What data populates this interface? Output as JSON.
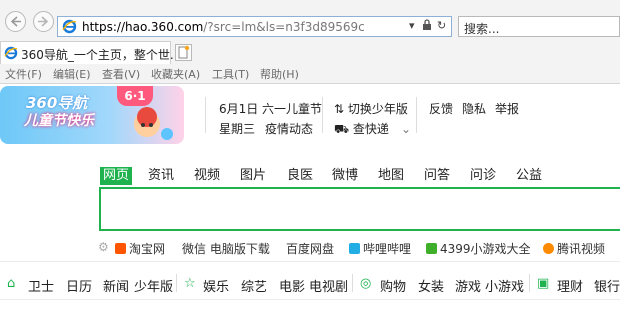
{
  "browser": {
    "url_host": "https://hao.360.com",
    "url_rest": "/?src=lm&ls=n3f3d89569c",
    "url_controls": [
      "▾",
      "🔒",
      "↻"
    ],
    "search_placeholder": "搜索...",
    "tab_title": "360导航_一个主页，整个世...",
    "menu": [
      "文件(F)",
      "编辑(E)",
      "查看(V)",
      "收藏夹(A)",
      "工具(T)",
      "帮助(H)"
    ]
  },
  "header": {
    "banner_line1": "360导航",
    "banner_line2": "儿童节快乐",
    "banner_badge": "6·1",
    "date": "6月1日",
    "festival": "六一儿童节",
    "weekday": "星期三",
    "epidemic": "疫情动态",
    "youth_switch": "切换少年版",
    "express": "查快递",
    "feedback": "反馈",
    "privacy": "隐私",
    "report": "举报"
  },
  "search_tabs": [
    "网页",
    "资讯",
    "视频",
    "图片",
    "良医",
    "微博",
    "地图",
    "问答",
    "问诊",
    "公益"
  ],
  "quick_links": [
    {
      "label": "淘宝网",
      "color": "#ff5500"
    },
    {
      "label": "微信 电脑版下载",
      "color": ""
    },
    {
      "label": "百度网盘",
      "color": ""
    },
    {
      "label": "哔哩哔哩",
      "color": "#23ade5"
    },
    {
      "label": "4399小游戏大全",
      "color": "#3fae29"
    },
    {
      "label": "腾讯视频",
      "color": "#ff8a00"
    }
  ],
  "bottom_nav": {
    "group1": [
      "卫士",
      "日历",
      "新闻",
      "少年版"
    ],
    "group2": [
      "娱乐",
      "综艺",
      "电影",
      "电视剧"
    ],
    "group3": [
      "购物",
      "女装",
      "游戏",
      "小游戏"
    ],
    "group4": [
      "理财",
      "银行"
    ]
  },
  "colors": {
    "accent": "#1fb24f",
    "link_blue": "#2a7fd8"
  }
}
